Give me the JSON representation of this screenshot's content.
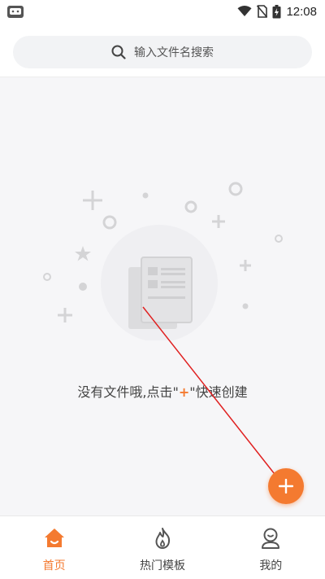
{
  "status_bar": {
    "time": "12:08"
  },
  "search": {
    "placeholder": "输入文件名搜索"
  },
  "empty_state": {
    "text_before": "没有文件哦,点击\"",
    "plus_symbol": "+",
    "text_after": "\"快速创建"
  },
  "fab": {
    "icon": "plus-icon"
  },
  "bottom_nav": {
    "items": [
      {
        "label": "首页",
        "icon": "home-icon",
        "active": true
      },
      {
        "label": "热门模板",
        "icon": "flame-icon",
        "active": false
      },
      {
        "label": "我的",
        "icon": "profile-icon",
        "active": false
      }
    ]
  },
  "colors": {
    "accent": "#f47a30",
    "annotation_arrow": "#e02020"
  }
}
